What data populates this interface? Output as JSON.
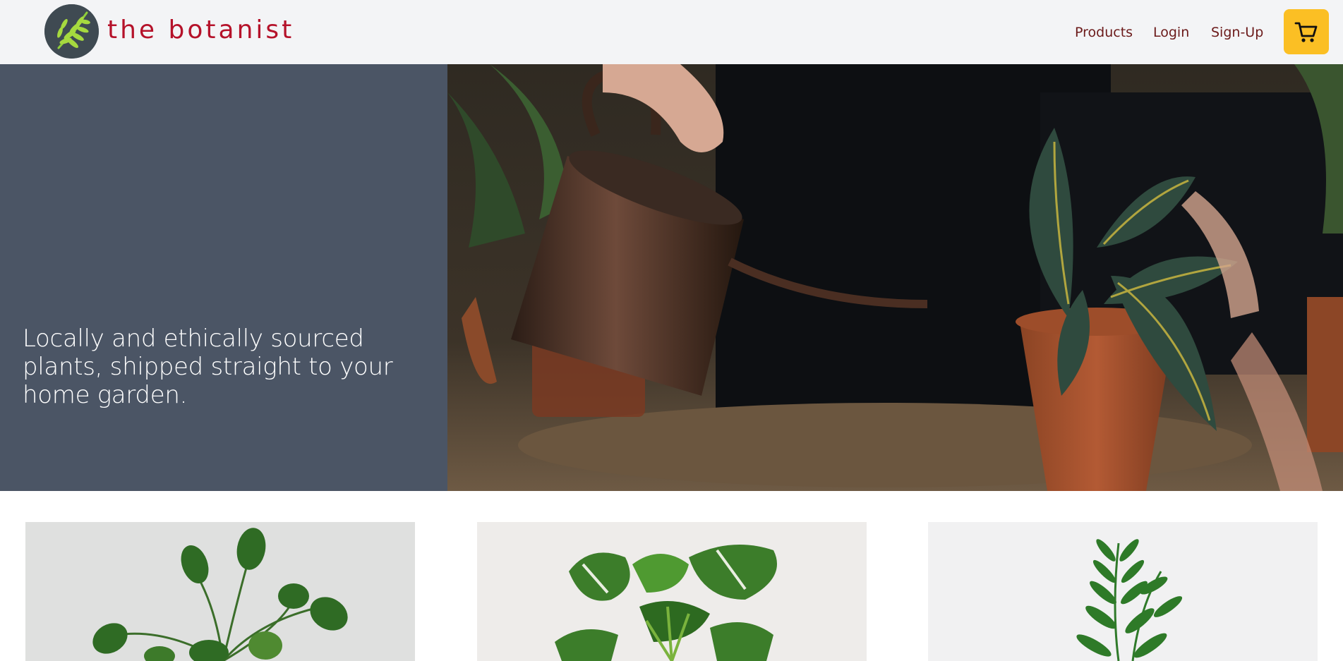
{
  "brand": {
    "name": "the botanist",
    "logo_icon": "leaf-logo-icon"
  },
  "nav": {
    "products": "Products",
    "login": "Login",
    "signup": "Sign-Up",
    "cart_icon": "shopping-cart-icon"
  },
  "hero": {
    "tagline": "Locally and ethically sourced plants, shipped straight to your home garden."
  },
  "products": [
    {
      "image": "pothos-plant-image"
    },
    {
      "image": "monstera-plant-image"
    },
    {
      "image": "zz-plant-image"
    }
  ],
  "colors": {
    "header_bg": "#f3f4f6",
    "brand": "#b5122a",
    "nav_link": "#6b1a1a",
    "cart_button": "#fbbf24",
    "hero_panel": "#4b5565"
  }
}
